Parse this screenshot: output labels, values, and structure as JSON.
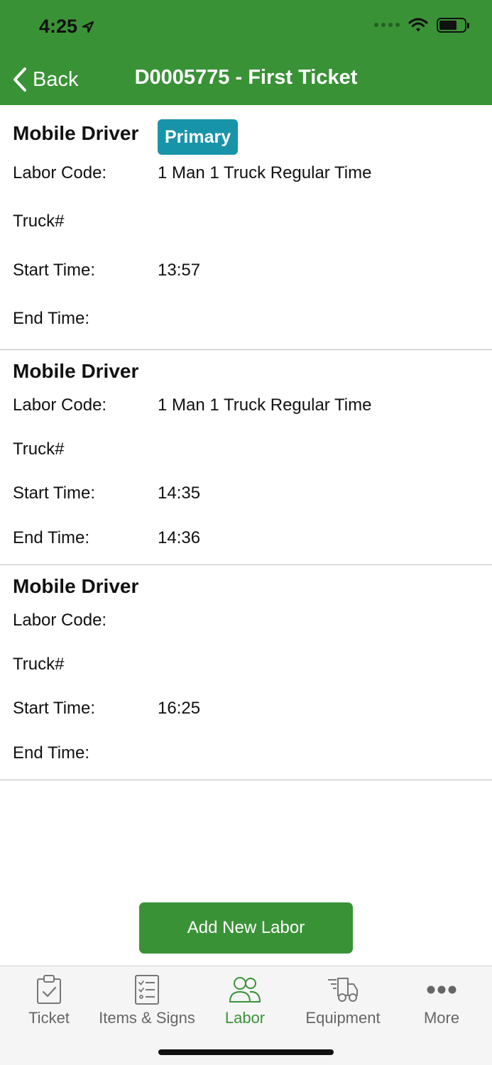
{
  "status_bar": {
    "time": "4:25"
  },
  "header": {
    "back_label": "Back",
    "title": "D0005775 - First Ticket"
  },
  "labor_entries": [
    {
      "title": "Mobile Driver",
      "badge": "Primary",
      "labor_code_label": "Labor Code:",
      "labor_code_value": "1 Man 1 Truck Regular Time",
      "truck_label": "Truck#",
      "truck_value": "",
      "start_label": "Start Time:",
      "start_value": "13:57",
      "end_label": "End Time:",
      "end_value": ""
    },
    {
      "title": "Mobile Driver",
      "labor_code_label": "Labor Code:",
      "labor_code_value": "1 Man 1 Truck Regular Time",
      "truck_label": "Truck#",
      "truck_value": "",
      "start_label": "Start Time:",
      "start_value": "14:35",
      "end_label": "End Time:",
      "end_value": "14:36"
    },
    {
      "title": "Mobile Driver",
      "labor_code_label": "Labor Code:",
      "labor_code_value": "",
      "truck_label": "Truck#",
      "truck_value": "",
      "start_label": "Start Time:",
      "start_value": "16:25",
      "end_label": "End Time:",
      "end_value": ""
    }
  ],
  "add_button_label": "Add New Labor",
  "tabs": [
    {
      "label": "Ticket",
      "icon": "clipboard-check-icon"
    },
    {
      "label": "Items & Signs",
      "icon": "checklist-icon"
    },
    {
      "label": "Labor",
      "icon": "people-icon",
      "active": true
    },
    {
      "label": "Equipment",
      "icon": "truck-icon"
    },
    {
      "label": "More",
      "icon": "more-dots-icon"
    }
  ],
  "colors": {
    "brand_green": "#3a9237",
    "badge_teal": "#1894a8",
    "tab_inactive": "#666666"
  }
}
